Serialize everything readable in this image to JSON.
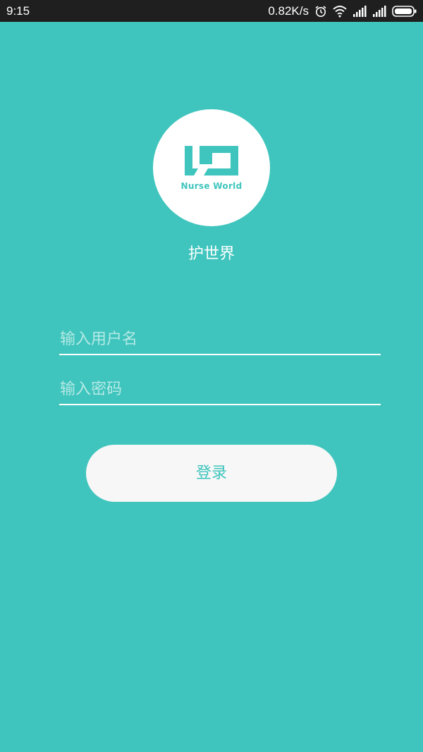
{
  "status_bar": {
    "time": "9:15",
    "net_speed": "0.82K/s",
    "icons": [
      "alarm-icon",
      "wifi-icon",
      "signal-icon",
      "signal-icon",
      "battery-icon"
    ]
  },
  "logo": {
    "text": "Nurse World",
    "color": "#3fc5bd"
  },
  "app": {
    "name": "护世界"
  },
  "form": {
    "username_placeholder": "输入用户名",
    "username_value": "",
    "password_placeholder": "输入密码",
    "password_value": ""
  },
  "login": {
    "label": "登录"
  },
  "colors": {
    "background": "#3fc5bd",
    "status_bar": "#1f1f1f",
    "button": "#f7f7f7"
  }
}
